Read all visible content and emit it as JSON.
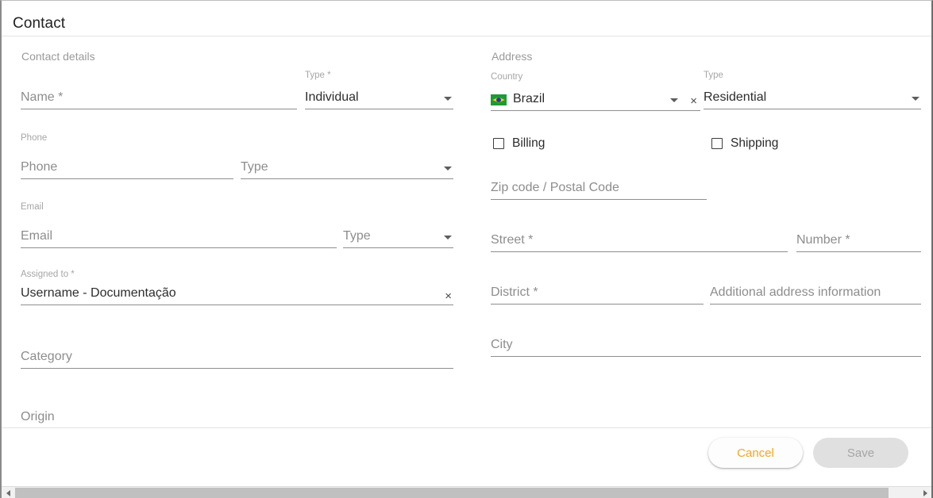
{
  "dialog": {
    "title": "Contact"
  },
  "sections": {
    "contact_details": "Contact details",
    "address": "Address"
  },
  "left": {
    "name": {
      "label": "",
      "placeholder": "Name *"
    },
    "type_person": {
      "label": "Type *",
      "value": "Individual",
      "caret": "chevron-down-icon"
    },
    "phone_group_label": "Phone",
    "phone": {
      "placeholder": "Phone"
    },
    "phone_type": {
      "placeholder": "Type",
      "caret": "chevron-down-icon"
    },
    "email_group_label": "Email",
    "email": {
      "placeholder": "Email"
    },
    "email_type": {
      "placeholder": "Type",
      "caret": "chevron-down-icon"
    },
    "assigned_to": {
      "label": "Assigned to *",
      "value": "Username - Documentação",
      "clear": "×"
    },
    "category": {
      "placeholder": "Category"
    },
    "origin": {
      "placeholder": "Origin"
    }
  },
  "right": {
    "country": {
      "label": "Country",
      "value": "Brazil",
      "flag": "brazil-flag-icon",
      "caret": "chevron-down-icon",
      "clear": "×"
    },
    "address_type": {
      "label": "Type",
      "value": "Residential",
      "caret": "chevron-down-icon"
    },
    "billing": {
      "label": "Billing",
      "checked": false
    },
    "shipping": {
      "label": "Shipping",
      "checked": false
    },
    "zip": {
      "placeholder": "Zip code / Postal Code"
    },
    "street": {
      "placeholder": "Street *"
    },
    "number": {
      "placeholder": "Number *"
    },
    "district": {
      "placeholder": "District *"
    },
    "additional": {
      "placeholder": "Additional address information"
    },
    "city": {
      "placeholder": "City"
    }
  },
  "footer": {
    "cancel_label": "Cancel",
    "save_label": "Save"
  },
  "colors": {
    "accent": "#f5a623",
    "text": "#2c2c2c",
    "muted": "#8d8d8d",
    "line": "#8e8e8e"
  }
}
